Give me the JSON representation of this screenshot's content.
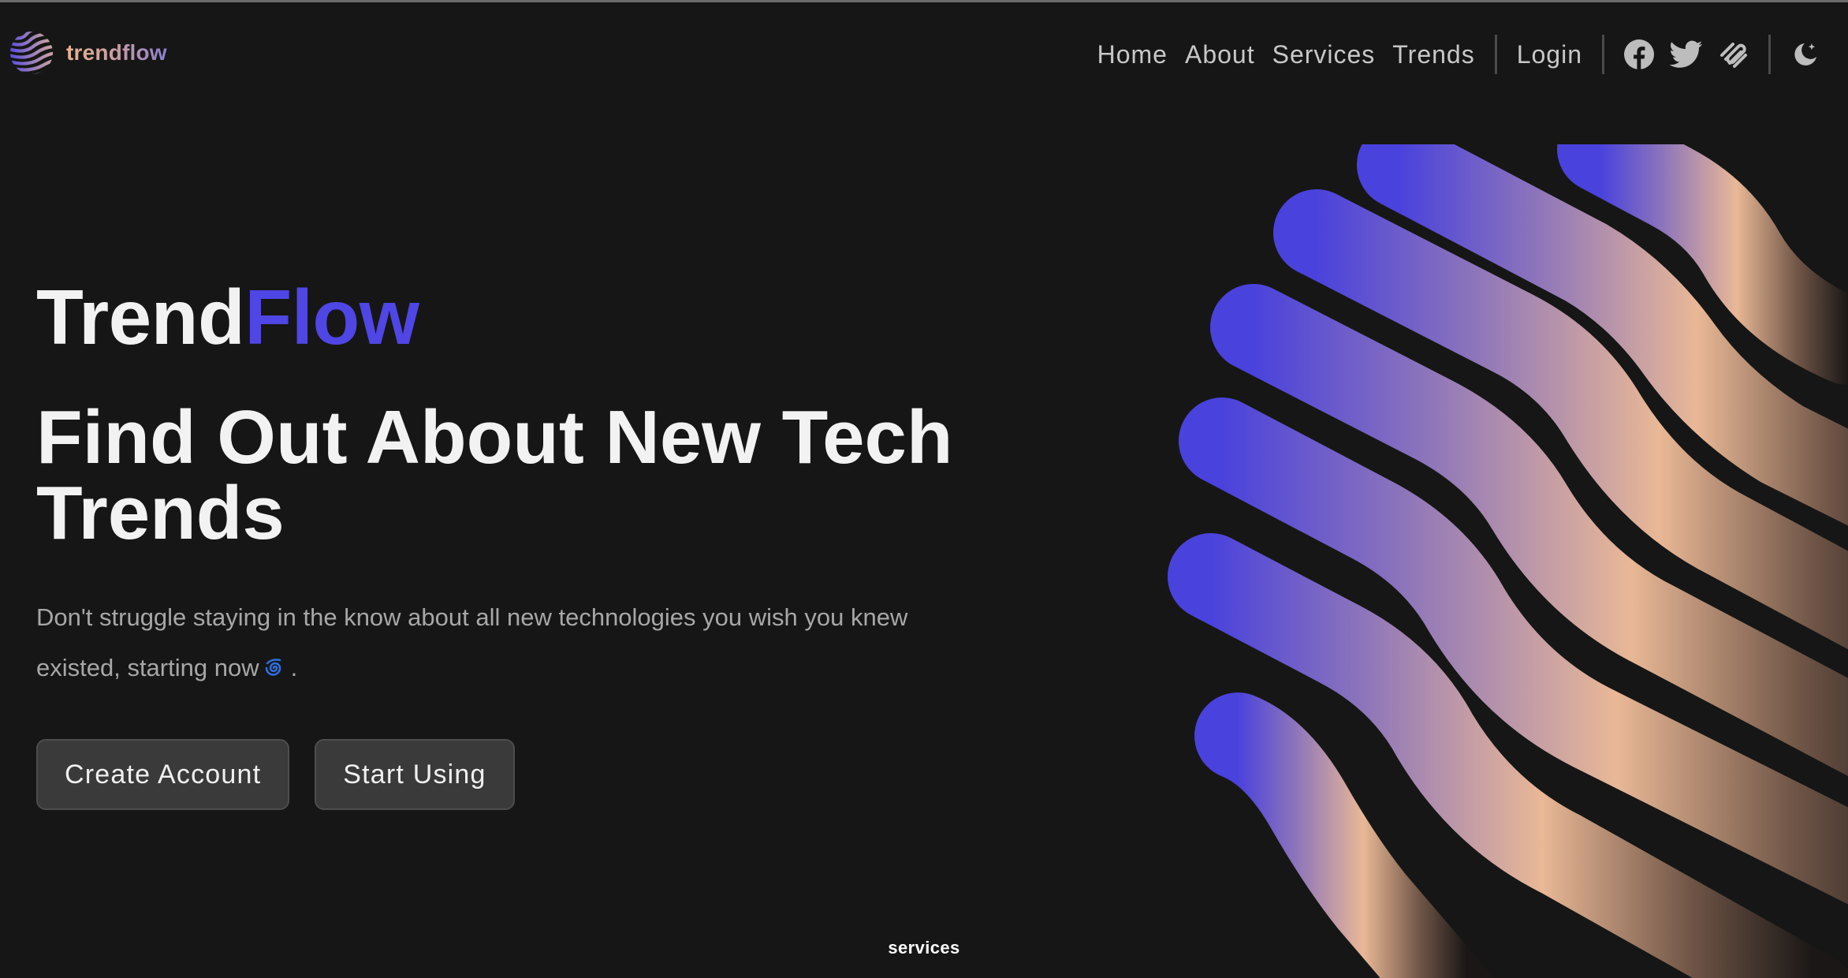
{
  "header": {
    "logo_text": "trendflow",
    "nav": {
      "home": "Home",
      "about": "About",
      "services": "Services",
      "trends": "Trends",
      "login": "Login"
    },
    "icons": [
      "facebook-icon",
      "twitter-icon",
      "squarespace-icon",
      "moon-icon"
    ]
  },
  "hero": {
    "brand_part1": "Trend",
    "brand_part2": "Flow",
    "headline": "Find Out About New Tech Trends",
    "lead_text": "Don't struggle staying in the know about all new technologies you wish you knew existed, starting now",
    "lead_end": ".",
    "lead_emoji": "cyclone-emoji",
    "buttons": {
      "create_account": "Create Account",
      "start_using": "Start Using"
    }
  },
  "section_label": "services",
  "colors": {
    "background": "#161616",
    "accent": "#4f46e5",
    "peach": "#e9b896",
    "text": "#f2f2f2",
    "muted_text": "#a7a7a7"
  }
}
